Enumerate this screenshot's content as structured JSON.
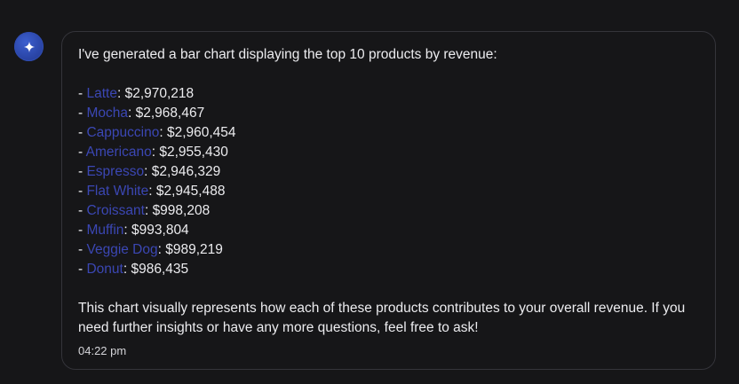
{
  "message": {
    "intro": "I've generated a bar chart displaying the top 10 products by revenue:",
    "items": [
      {
        "product": "Latte",
        "value": "$2,970,218"
      },
      {
        "product": "Mocha",
        "value": "$2,968,467"
      },
      {
        "product": "Cappuccino",
        "value": "$2,960,454"
      },
      {
        "product": "Americano",
        "value": "$2,955,430"
      },
      {
        "product": "Espresso",
        "value": "$2,946,329"
      },
      {
        "product": "Flat White",
        "value": "$2,945,488"
      },
      {
        "product": "Croissant",
        "value": "$998,208"
      },
      {
        "product": "Muffin",
        "value": "$993,804"
      },
      {
        "product": "Veggie Dog",
        "value": "$989,219"
      },
      {
        "product": "Donut",
        "value": "$986,435"
      }
    ],
    "outro": "This chart visually represents how each of these products contributes to your overall revenue. If you need further insights or have any more questions, feel free to ask!",
    "time": "04:22 pm"
  },
  "assistant": {
    "avatar_icon": "sparkle-icon"
  },
  "colors": {
    "background": "#161618",
    "bubble_border": "#34343a",
    "product_link": "#3b47b4",
    "avatar": "#2b46a8"
  }
}
